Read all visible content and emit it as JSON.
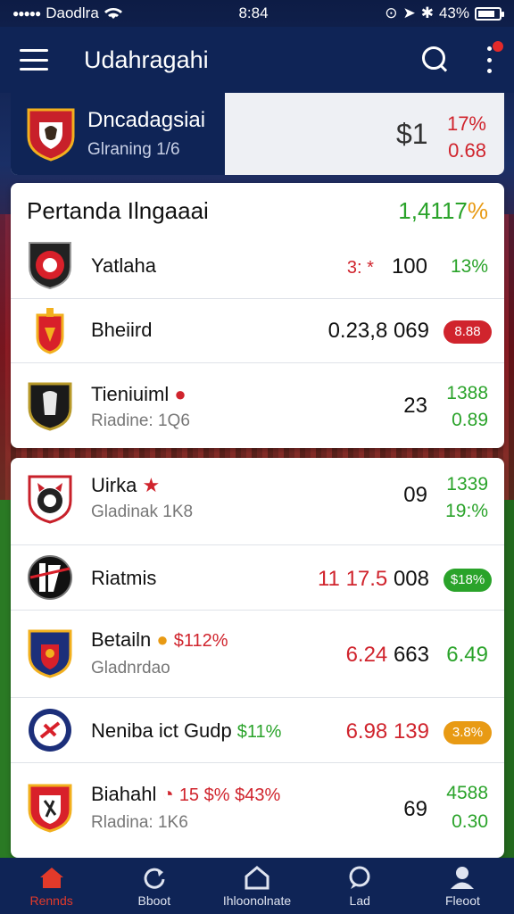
{
  "status_bar": {
    "carrier": "Daodlra",
    "time": "8:84",
    "battery": "43%"
  },
  "app_bar": {
    "title": "Udahragahi"
  },
  "featured": {
    "name": "Dncadagsiai",
    "subtitle": "Glraning 1/6",
    "price": "$1",
    "change_pct": "17%",
    "change_val": "0.68"
  },
  "card1": {
    "title": "Pertanda Ilngaaai",
    "value": "1,4117",
    "value_pct": "%",
    "rows": [
      {
        "name": "Yatlaha",
        "sub": "",
        "price_prefix": "3: *",
        "price": "100",
        "change": "13%",
        "change_color": "#2aa32a"
      },
      {
        "name": "Bheiird",
        "sub": "",
        "price": "0.23,8 069",
        "pill": "8.88",
        "pill_color": "#d0242d"
      },
      {
        "name": "Tieniuiml",
        "sub": "Riadine: 1Q6",
        "price": "23",
        "change_top": "1388",
        "change_bottom": "0.89"
      }
    ]
  },
  "card2": {
    "rows": [
      {
        "name": "Uirka",
        "sub": "Gladinak 1K8",
        "price": "09",
        "change_top": "1339",
        "change_bottom": "19:%"
      },
      {
        "name": "Riatmis",
        "price": "11 17.5",
        "price_suffix": "008",
        "pill": "$18%",
        "pill_color": "#2aa32a"
      },
      {
        "name": "Betailn",
        "tag": "$112%",
        "sub": "Gladnrdao",
        "price": "6.24",
        "price_suffix": "663",
        "change": "6.49"
      },
      {
        "name": "Neniba ict Gudp",
        "tag": "$11%",
        "price": "6.98",
        "price_suffix": "139",
        "pill": "3.8%",
        "pill_color": "#e89a14"
      },
      {
        "name": "Biahahl",
        "tag": "15 $% $43%",
        "sub": "Rladina: 1K6",
        "price": "69",
        "change_top": "4588",
        "change_bottom": "0.30"
      }
    ]
  },
  "bottom_nav": [
    {
      "label": "Rennds",
      "icon": "home-icon"
    },
    {
      "label": "Bboot",
      "icon": "refresh-icon"
    },
    {
      "label": "Ihloonolnate",
      "icon": "house-outline-icon"
    },
    {
      "label": "Lad",
      "icon": "chat-icon"
    },
    {
      "label": "Fleoot",
      "icon": "profile-icon"
    }
  ]
}
